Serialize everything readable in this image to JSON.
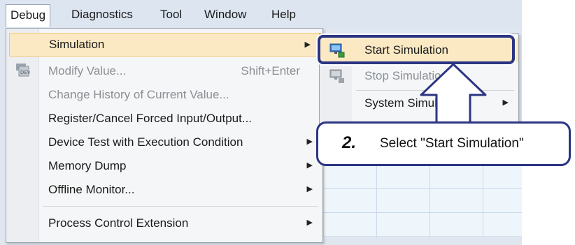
{
  "menubar": {
    "items": [
      {
        "label": "Debug"
      },
      {
        "label": "Diagnostics"
      },
      {
        "label": "Tool"
      },
      {
        "label": "Window"
      },
      {
        "label": "Help"
      }
    ]
  },
  "debug_menu": {
    "items": [
      {
        "label": "Simulation",
        "state": "highlighted",
        "has_submenu": true
      },
      {
        "label": "Modify Value...",
        "shortcut": "Shift+Enter",
        "state": "disabled"
      },
      {
        "label": "Change History of Current Value...",
        "state": "disabled"
      },
      {
        "label": "Register/Cancel Forced Input/Output...",
        "state": "enabled"
      },
      {
        "label": "Device Test with Execution Condition",
        "state": "enabled",
        "has_submenu": true
      },
      {
        "label": "Memory Dump",
        "state": "enabled",
        "has_submenu": true
      },
      {
        "label": "Offline Monitor...",
        "state": "enabled",
        "has_submenu": true
      },
      {
        "label": "Process Control Extension",
        "state": "enabled",
        "has_submenu": true
      }
    ]
  },
  "simulation_submenu": {
    "items": [
      {
        "label": "Start Simulation",
        "state": "highlighted"
      },
      {
        "label": "Stop Simulation",
        "state": "disabled"
      },
      {
        "label": "System Simulation",
        "state": "enabled",
        "has_submenu": true
      }
    ]
  },
  "callout": {
    "step_number": "2.",
    "text": "Select \"Start Simulation\""
  },
  "colors": {
    "highlight_fill": "#fbe9c4",
    "callout_border": "#2b3582",
    "menu_background": "#f5f6f7",
    "disabled_text": "#8a8f95"
  }
}
